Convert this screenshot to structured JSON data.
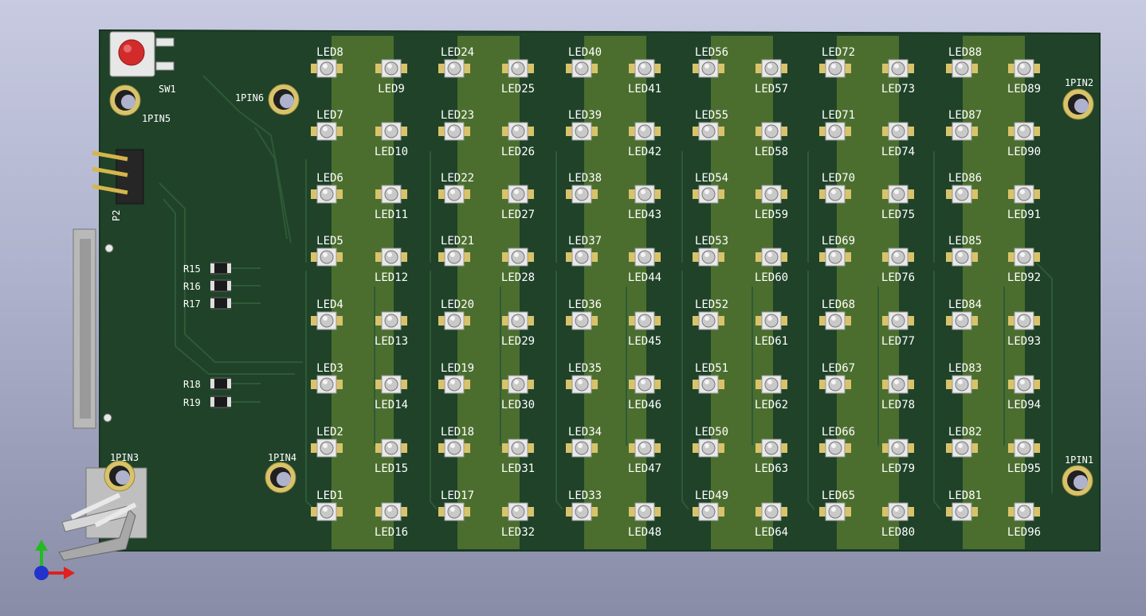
{
  "board": {
    "colors": {
      "substrate": "#1f4229",
      "copper_strip": "#4b6e2f",
      "trace": "#2e5a36",
      "silkscreen": "#ffffff",
      "pad": "#d9c36a",
      "led_dome": "#c9c9c9",
      "button_red": "#d32b2b"
    }
  },
  "components": {
    "switch": "SW1",
    "header": "P2",
    "mount_holes": [
      "1PIN1",
      "1PIN2",
      "1PIN3",
      "1PIN4",
      "1PIN5",
      "1PIN6"
    ],
    "resistors": [
      "R15",
      "R16",
      "R17",
      "R18",
      "R19"
    ]
  },
  "led_grid": {
    "columns": 12,
    "rows": 8
  },
  "axes": {
    "x_color": "#e02020",
    "y_color": "#22bb22",
    "z_color": "#2233cc"
  }
}
